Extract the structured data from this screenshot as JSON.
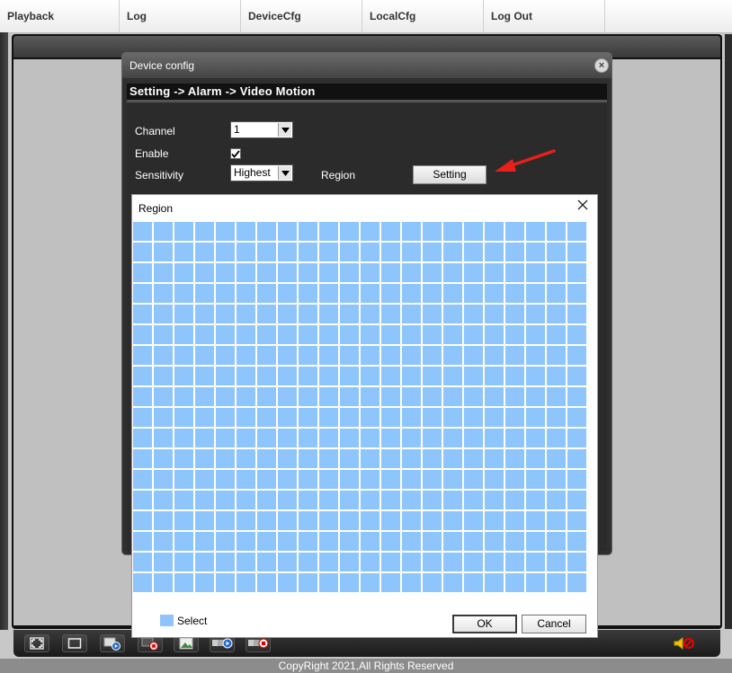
{
  "menu": {
    "items": [
      {
        "label": "Playback"
      },
      {
        "label": "Log"
      },
      {
        "label": "DeviceCfg"
      },
      {
        "label": "LocalCfg"
      },
      {
        "label": "Log Out"
      }
    ]
  },
  "device_config": {
    "title": "Device config",
    "breadcrumb": "Setting -> Alarm -> Video Motion",
    "fields": {
      "channel_label": "Channel",
      "channel_value": "1",
      "enable_label": "Enable",
      "enable_checked": true,
      "sensitivity_label": "Sensitivity",
      "sensitivity_value": "Highest",
      "region_label": "Region",
      "setting_button": "Setting"
    }
  },
  "region_dialog": {
    "title": "Region",
    "grid": {
      "columns": 22,
      "rows": 18,
      "selected_color": "#8fc5fd"
    },
    "legend_label": "Select",
    "ok_button": "OK",
    "cancel_button": "Cancel"
  },
  "toolbar": {
    "icons": [
      "fullscreen-icon",
      "single-view-icon",
      "record-play-icon",
      "record-stop-icon",
      "snapshot-icon",
      "play-all-icon",
      "stop-all-icon",
      "audio-mute-icon"
    ]
  },
  "footer": {
    "text": "CopyRight 2021,All Rights Reserved"
  },
  "colors": {
    "grid_cell": "#8fc5fd",
    "annotation_arrow": "#e8201a"
  }
}
